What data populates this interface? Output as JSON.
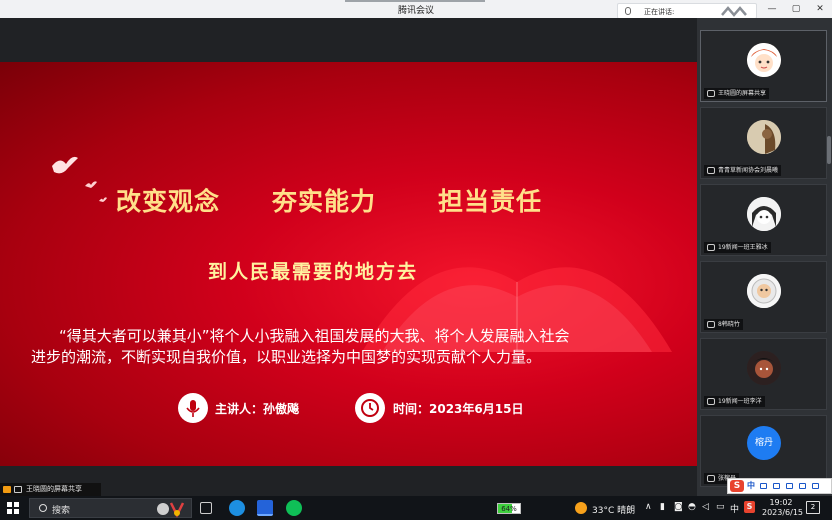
{
  "window": {
    "title": "腾讯会议",
    "minimize_glyph": "—",
    "maximize_glyph": "▢",
    "close_glyph": "✕"
  },
  "speaking": {
    "label": "正在讲话:"
  },
  "slide": {
    "headline_1": "改变观念",
    "headline_2": "夯实能力",
    "headline_3": "担当责任",
    "subtitle": "到人民最需要的地方去",
    "body_line_1": "“得其大者可以兼其小”将个人小我融入祖国发展的大我、将个人发展融入社会",
    "body_line_2": "进步的潮流，不断实现自我价值，以职业选择为中国梦的实现贡献个人力量。",
    "presenter": "主讲人：孙傲飚",
    "time": "时间：2023年6月15日",
    "colors": {
      "headline": "#ffe08a",
      "background": "#d1001b"
    }
  },
  "participants": [
    {
      "name": "王晓圆的屏幕共享",
      "avatar": "cartoon-girl-avatar"
    },
    {
      "name": "青青草新闻协会刘晨曦",
      "avatar": "photo-avatar"
    },
    {
      "name": "19新闻一班王雅冰",
      "avatar": "anime-avatar"
    },
    {
      "name": "8韩晓竹",
      "avatar": "astronaut-avatar"
    },
    {
      "name": "19新闻一班李洋",
      "avatar": "dark-avatar"
    },
    {
      "name": "张榕丹",
      "avatar_text": "榕丹",
      "avatar_color": "#1e7cf2"
    }
  ],
  "screen_share_label": "王晓圆的屏幕共享",
  "ime": {
    "logo": "S",
    "mode": "中"
  },
  "taskbar": {
    "search_placeholder": "搜索",
    "battery_text": "64%",
    "battery_level": 64,
    "weather": "33°C 晴朗",
    "ime_label": "中",
    "time": "19:02",
    "date": "2023/6/15",
    "notification_count": "2"
  }
}
